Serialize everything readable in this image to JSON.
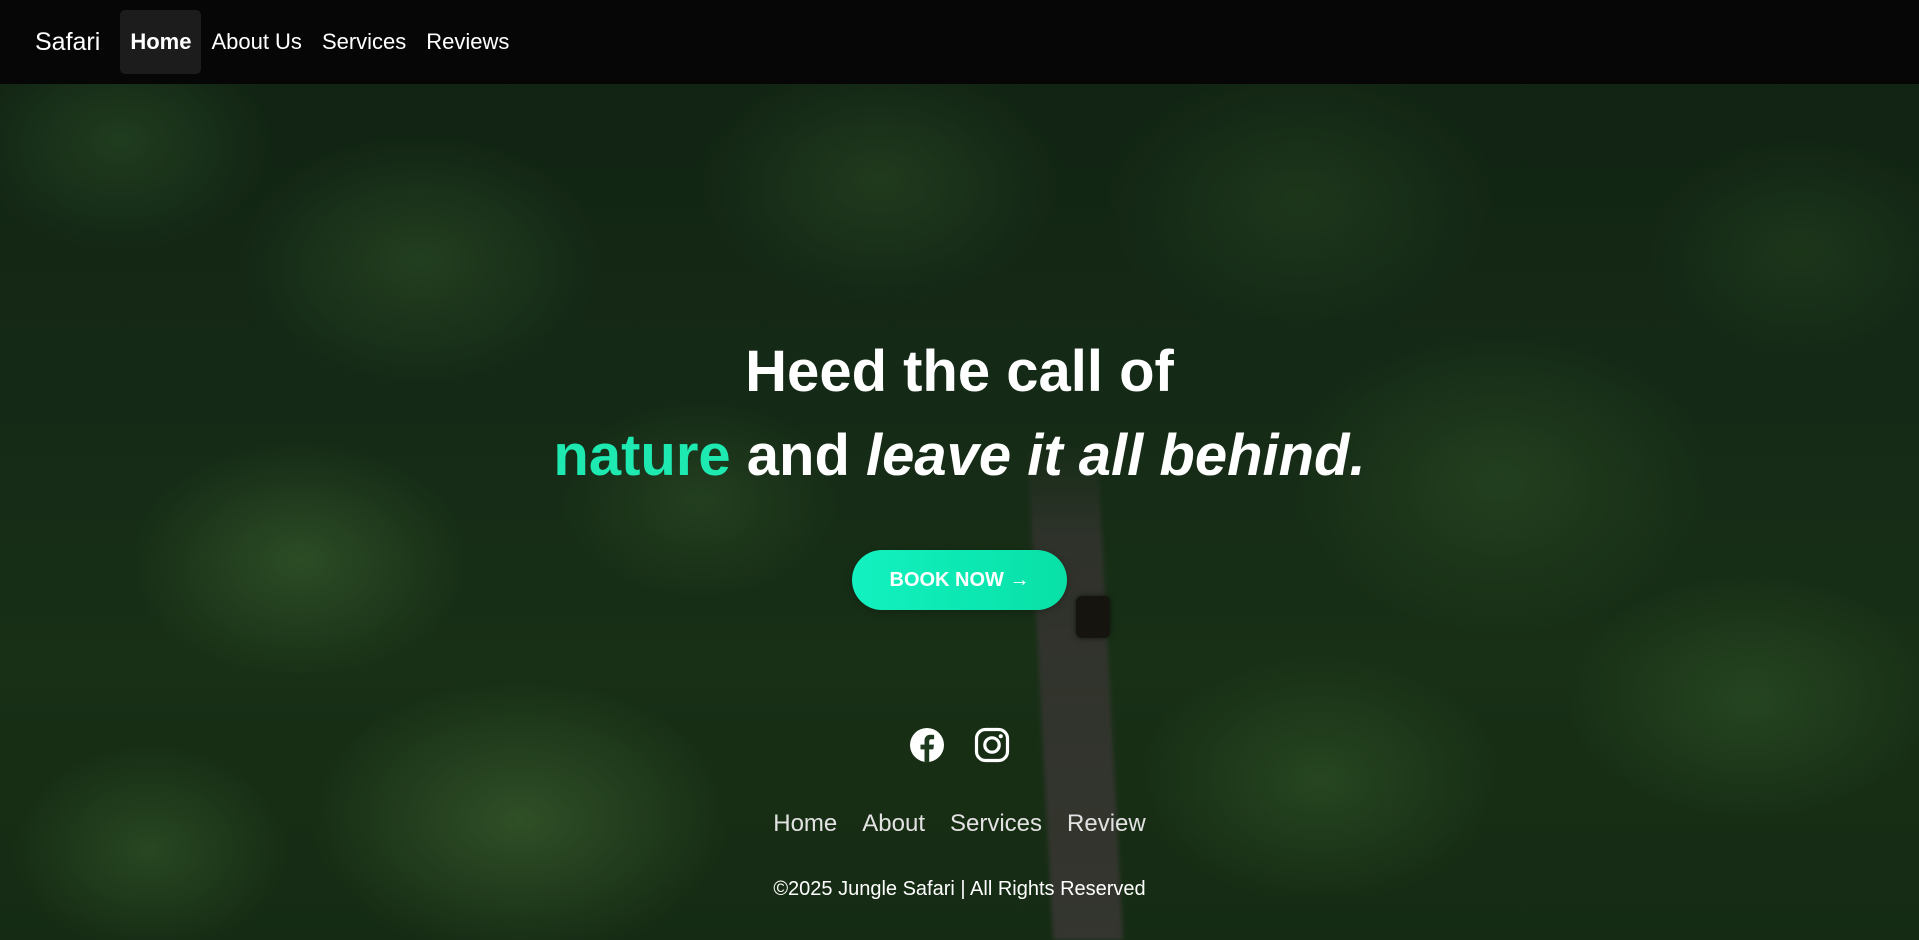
{
  "navbar": {
    "brand": "Safari",
    "links": [
      {
        "label": "Home",
        "active": true
      },
      {
        "label": "About Us",
        "active": false
      },
      {
        "label": "Services",
        "active": false
      },
      {
        "label": "Reviews",
        "active": false
      }
    ]
  },
  "hero": {
    "line1": "Heed the call of",
    "accent_word": "nature",
    "mid_text": " and ",
    "italic_text": "leave it all behind.",
    "cta_label": "BOOK NOW →",
    "accent_color": "#1de9b0"
  },
  "footer": {
    "social": [
      {
        "icon": "facebook-icon"
      },
      {
        "icon": "instagram-icon"
      }
    ],
    "links": [
      "Home",
      "About",
      "Services",
      "Review"
    ],
    "copyright": "©2025 Jungle Safari | All Rights Reserved"
  }
}
